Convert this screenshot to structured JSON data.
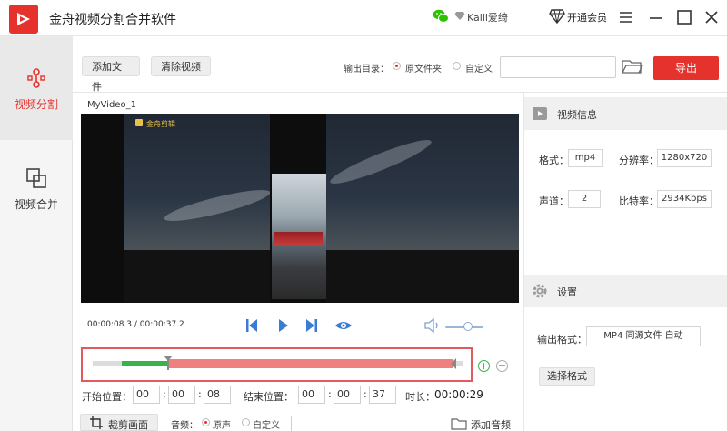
{
  "app": {
    "title": "金舟视频分割合并软件",
    "username": "Kaili爱绮",
    "upgrade_label": "开通会员",
    "accent_color": "#e5322d"
  },
  "sidebar": {
    "items": [
      {
        "label": "视频分割",
        "icon": "split-icon",
        "active": true
      },
      {
        "label": "视频合并",
        "icon": "merge-icon",
        "active": false
      }
    ]
  },
  "toolbar": {
    "add_file_label": "添加文件",
    "clear_video_label": "清除视频",
    "output_dir_label": "输出目录：",
    "output_options": [
      {
        "label": "原文件夹",
        "selected": true
      },
      {
        "label": "自定义",
        "selected": false
      }
    ],
    "output_path_value": "",
    "export_label": "导出"
  },
  "player": {
    "video_title": "MyVideo_1",
    "watermark_text": "金舟剪辑",
    "time_display": "00:00:08.3 / 00:00:37.2",
    "volume_fraction": 0.6
  },
  "timeline": {
    "start_label": "开始位置：",
    "end_label": "结束位置：",
    "duration_label": "时长：",
    "duration_value": "00:00:29",
    "start_h": "00",
    "start_m": "00",
    "start_s": "08",
    "end_h": "00",
    "end_m": "00",
    "end_s": "37",
    "colon": ":"
  },
  "bottom": {
    "crop_label": "裁剪画面",
    "audio_label": "音频：",
    "audio_options": [
      {
        "label": "原声",
        "selected": true
      },
      {
        "label": "自定义",
        "selected": false
      }
    ],
    "audio_path_value": "",
    "add_audio_label": "添加音频"
  },
  "video_info": {
    "title": "视频信息",
    "format_label": "格式：",
    "format_value": "mp4",
    "resolution_label": "分辨率：",
    "resolution_value": "1280x720",
    "channels_label": "声道：",
    "channels_value": "2",
    "bitrate_label": "比特率：",
    "bitrate_value": "2934Kbps"
  },
  "settings": {
    "title": "设置",
    "output_format_label": "输出格式：",
    "output_format_value": "MP4 同源文件 自动",
    "choose_format_label": "选择格式"
  }
}
